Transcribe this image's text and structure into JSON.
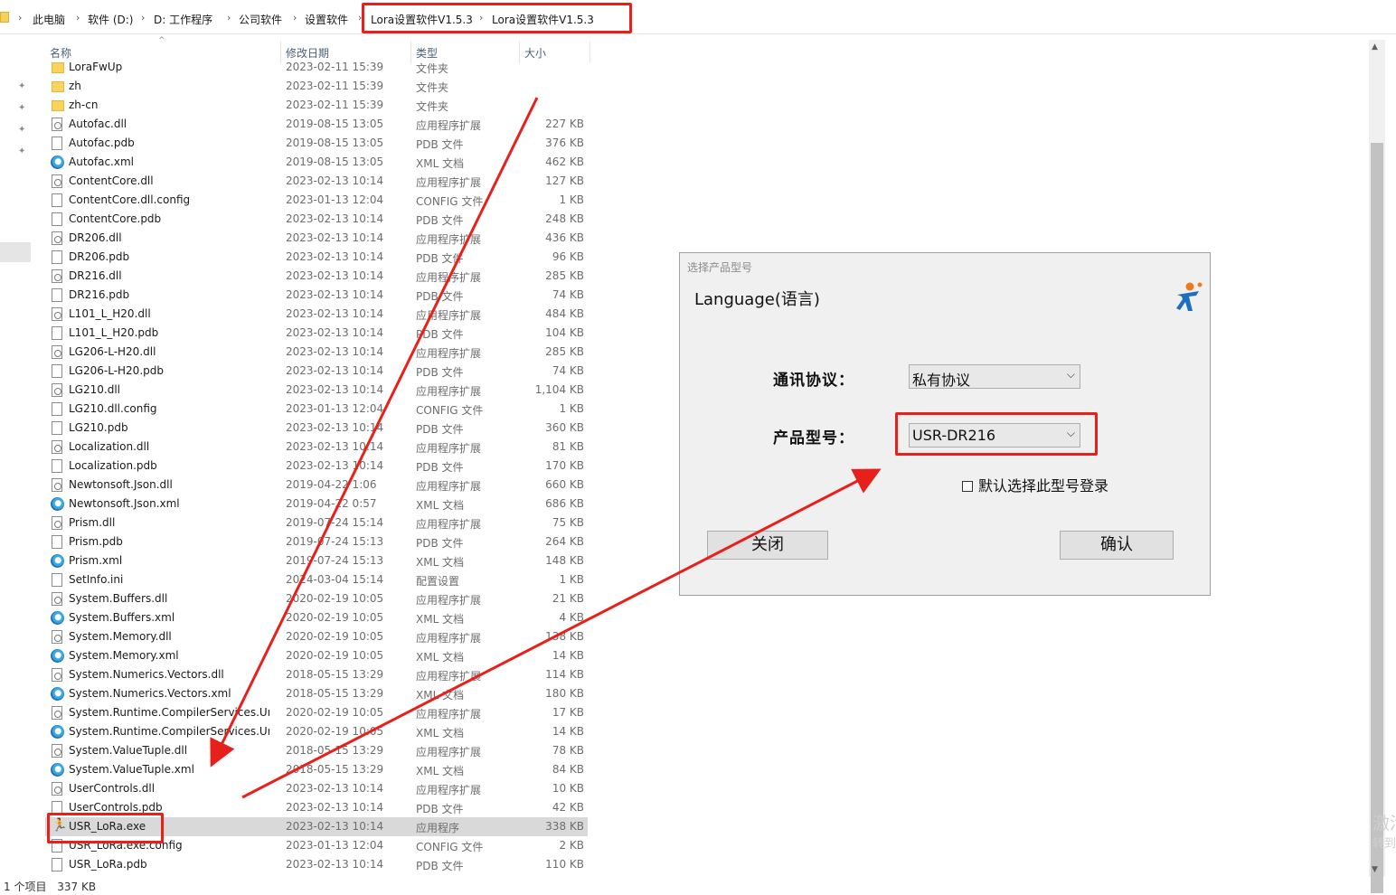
{
  "breadcrumb": {
    "items": [
      "此电脑",
      "软件 (D:)",
      "D:  工作程序",
      "公司软件",
      "设置软件",
      "Lora设置软件V1.5.3",
      "Lora设置软件V1.5.3"
    ]
  },
  "columns": {
    "name": "名称",
    "date": "修改日期",
    "type": "类型",
    "size": "大小"
  },
  "files": [
    {
      "name": "LoraFwUp",
      "date": "2023-02-11 15:39",
      "type": "文件夹",
      "size": "",
      "icon": "folder"
    },
    {
      "name": "zh",
      "date": "2023-02-11 15:39",
      "type": "文件夹",
      "size": "",
      "icon": "folder"
    },
    {
      "name": "zh-cn",
      "date": "2023-02-11 15:39",
      "type": "文件夹",
      "size": "",
      "icon": "folder"
    },
    {
      "name": "Autofac.dll",
      "date": "2019-08-15 13:05",
      "type": "应用程序扩展",
      "size": "227 KB",
      "icon": "dll"
    },
    {
      "name": "Autofac.pdb",
      "date": "2019-08-15 13:05",
      "type": "PDB 文件",
      "size": "376 KB",
      "icon": "pdb"
    },
    {
      "name": "Autofac.xml",
      "date": "2019-08-15 13:05",
      "type": "XML 文档",
      "size": "462 KB",
      "icon": "xml"
    },
    {
      "name": "ContentCore.dll",
      "date": "2023-02-13 10:14",
      "type": "应用程序扩展",
      "size": "127 KB",
      "icon": "dll"
    },
    {
      "name": "ContentCore.dll.config",
      "date": "2023-01-13 12:04",
      "type": "CONFIG 文件",
      "size": "1 KB",
      "icon": "pdb"
    },
    {
      "name": "ContentCore.pdb",
      "date": "2023-02-13 10:14",
      "type": "PDB 文件",
      "size": "248 KB",
      "icon": "pdb"
    },
    {
      "name": "DR206.dll",
      "date": "2023-02-13 10:14",
      "type": "应用程序扩展",
      "size": "436 KB",
      "icon": "dll"
    },
    {
      "name": "DR206.pdb",
      "date": "2023-02-13 10:14",
      "type": "PDB 文件",
      "size": "96 KB",
      "icon": "pdb"
    },
    {
      "name": "DR216.dll",
      "date": "2023-02-13 10:14",
      "type": "应用程序扩展",
      "size": "285 KB",
      "icon": "dll"
    },
    {
      "name": "DR216.pdb",
      "date": "2023-02-13 10:14",
      "type": "PDB 文件",
      "size": "74 KB",
      "icon": "pdb"
    },
    {
      "name": "L101_L_H20.dll",
      "date": "2023-02-13 10:14",
      "type": "应用程序扩展",
      "size": "484 KB",
      "icon": "dll"
    },
    {
      "name": "L101_L_H20.pdb",
      "date": "2023-02-13 10:14",
      "type": "PDB 文件",
      "size": "104 KB",
      "icon": "pdb"
    },
    {
      "name": "LG206-L-H20.dll",
      "date": "2023-02-13 10:14",
      "type": "应用程序扩展",
      "size": "285 KB",
      "icon": "dll"
    },
    {
      "name": "LG206-L-H20.pdb",
      "date": "2023-02-13 10:14",
      "type": "PDB 文件",
      "size": "74 KB",
      "icon": "pdb"
    },
    {
      "name": "LG210.dll",
      "date": "2023-02-13 10:14",
      "type": "应用程序扩展",
      "size": "1,104 KB",
      "icon": "dll"
    },
    {
      "name": "LG210.dll.config",
      "date": "2023-01-13 12:04",
      "type": "CONFIG 文件",
      "size": "1 KB",
      "icon": "pdb"
    },
    {
      "name": "LG210.pdb",
      "date": "2023-02-13 10:14",
      "type": "PDB 文件",
      "size": "360 KB",
      "icon": "pdb"
    },
    {
      "name": "Localization.dll",
      "date": "2023-02-13 10:14",
      "type": "应用程序扩展",
      "size": "81 KB",
      "icon": "dll"
    },
    {
      "name": "Localization.pdb",
      "date": "2023-02-13 10:14",
      "type": "PDB 文件",
      "size": "170 KB",
      "icon": "pdb"
    },
    {
      "name": "Newtonsoft.Json.dll",
      "date": "2019-04-22 1:06",
      "type": "应用程序扩展",
      "size": "660 KB",
      "icon": "dll"
    },
    {
      "name": "Newtonsoft.Json.xml",
      "date": "2019-04-22 0:57",
      "type": "XML 文档",
      "size": "686 KB",
      "icon": "xml"
    },
    {
      "name": "Prism.dll",
      "date": "2019-07-24 15:14",
      "type": "应用程序扩展",
      "size": "75 KB",
      "icon": "dll"
    },
    {
      "name": "Prism.pdb",
      "date": "2019-07-24 15:13",
      "type": "PDB 文件",
      "size": "264 KB",
      "icon": "pdb"
    },
    {
      "name": "Prism.xml",
      "date": "2019-07-24 15:13",
      "type": "XML 文档",
      "size": "148 KB",
      "icon": "xml"
    },
    {
      "name": "SetInfo.ini",
      "date": "2024-03-04 15:14",
      "type": "配置设置",
      "size": "1 KB",
      "icon": "ini"
    },
    {
      "name": "System.Buffers.dll",
      "date": "2020-02-19 10:05",
      "type": "应用程序扩展",
      "size": "21 KB",
      "icon": "dll"
    },
    {
      "name": "System.Buffers.xml",
      "date": "2020-02-19 10:05",
      "type": "XML 文档",
      "size": "4 KB",
      "icon": "xml"
    },
    {
      "name": "System.Memory.dll",
      "date": "2020-02-19 10:05",
      "type": "应用程序扩展",
      "size": "138 KB",
      "icon": "dll"
    },
    {
      "name": "System.Memory.xml",
      "date": "2020-02-19 10:05",
      "type": "XML 文档",
      "size": "14 KB",
      "icon": "xml"
    },
    {
      "name": "System.Numerics.Vectors.dll",
      "date": "2018-05-15 13:29",
      "type": "应用程序扩展",
      "size": "114 KB",
      "icon": "dll"
    },
    {
      "name": "System.Numerics.Vectors.xml",
      "date": "2018-05-15 13:29",
      "type": "XML 文档",
      "size": "180 KB",
      "icon": "xml"
    },
    {
      "name": "System.Runtime.CompilerServices.Un...",
      "date": "2020-02-19 10:05",
      "type": "应用程序扩展",
      "size": "17 KB",
      "icon": "dll"
    },
    {
      "name": "System.Runtime.CompilerServices.Un...",
      "date": "2020-02-19 10:05",
      "type": "XML 文档",
      "size": "14 KB",
      "icon": "xml"
    },
    {
      "name": "System.ValueTuple.dll",
      "date": "2018-05-15 13:29",
      "type": "应用程序扩展",
      "size": "78 KB",
      "icon": "dll"
    },
    {
      "name": "System.ValueTuple.xml",
      "date": "2018-05-15 13:29",
      "type": "XML 文档",
      "size": "84 KB",
      "icon": "xml"
    },
    {
      "name": "UserControls.dll",
      "date": "2023-02-13 10:14",
      "type": "应用程序扩展",
      "size": "10 KB",
      "icon": "dll"
    },
    {
      "name": "UserControls.pdb",
      "date": "2023-02-13 10:14",
      "type": "PDB 文件",
      "size": "42 KB",
      "icon": "pdb"
    },
    {
      "name": "USR_LoRa.exe",
      "date": "2023-02-13 10:14",
      "type": "应用程序",
      "size": "338 KB",
      "icon": "exe",
      "selected": true
    },
    {
      "name": "USR_LoRa.exe.config",
      "date": "2023-01-13 12:04",
      "type": "CONFIG 文件",
      "size": "2 KB",
      "icon": "pdb"
    },
    {
      "name": "USR_LoRa.pdb",
      "date": "2023-02-13 10:14",
      "type": "PDB 文件",
      "size": "110 KB",
      "icon": "pdb"
    }
  ],
  "status_bar": {
    "count": "1 个项目",
    "size": "337 KB"
  },
  "watermark": {
    "line1": "激活",
    "line2": "转到"
  },
  "dialog": {
    "title": "选择产品型号",
    "language_label": "Language(语言)",
    "protocol_label": "通讯协议：",
    "protocol_value": "私有协议",
    "model_label": "产品型号：",
    "model_value": "USR-DR216",
    "checkbox_label": "默认选择此型号登录",
    "checkbox_checked": false,
    "close_button": "关闭",
    "confirm_button": "确认"
  },
  "annotation_color": "#e8201c"
}
